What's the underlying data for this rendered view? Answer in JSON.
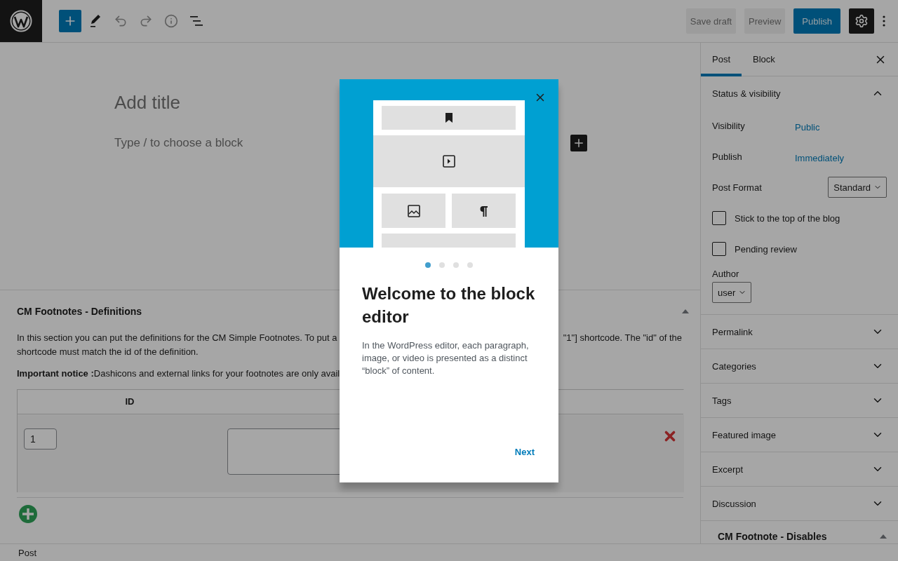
{
  "topbar": {
    "tools": [
      {
        "kind": "inserter",
        "disabled": false
      },
      {
        "kind": "tools",
        "disabled": false
      },
      {
        "kind": "undo",
        "disabled": true
      },
      {
        "kind": "redo",
        "disabled": true
      },
      {
        "kind": "info",
        "disabled": true
      },
      {
        "kind": "list",
        "disabled": false
      }
    ],
    "actions": [
      {
        "label": "Save draft",
        "kind": "tertiary"
      },
      {
        "label": "Preview",
        "kind": "tertiary"
      },
      {
        "label": "Publish",
        "kind": "primary"
      }
    ],
    "settings": {
      "pressed": true
    }
  },
  "editor": {
    "title_placeholder": "Add title",
    "block_placeholder": "Type / to choose a block"
  },
  "metabox": {
    "title": "CM Footnotes - Definitions",
    "expanded": true,
    "intro": [
      "In this section you can put the definitions for the CM Simple Footnotes. To put a",
      "\"1\"] shortcode. The \"id\" of the",
      "shortcode must match the id of the definition."
    ],
    "notice": "**Important notice :**Dashicons and external links for your footnotes are only avail",
    "columns": [
      "ID"
    ],
    "rows": [
      {
        "id": "1"
      }
    ]
  },
  "sidebar": {
    "tabs": [
      {
        "label": "Post",
        "selected": true
      },
      {
        "label": "Block",
        "selected": false
      }
    ],
    "status_panel": {
      "title": "Status & visibility",
      "expanded": true,
      "rows": [
        {
          "label": "Visibility",
          "value": "Public"
        },
        {
          "label": "Publish",
          "value": "Immediately"
        }
      ],
      "post_format": {
        "label": "Post Format",
        "value": "Standard"
      },
      "checkboxes": [
        {
          "label": "Stick to the top of the blog",
          "checked": false
        },
        {
          "label": "Pending review",
          "checked": false
        }
      ],
      "author": {
        "label": "Author",
        "value": "user"
      }
    },
    "panels": [
      {
        "title": "Permalink",
        "expanded": false
      },
      {
        "title": "Categories",
        "expanded": false
      },
      {
        "title": "Tags",
        "expanded": false
      },
      {
        "title": "Featured image",
        "expanded": false
      },
      {
        "title": "Excerpt",
        "expanded": false
      },
      {
        "title": "Discussion",
        "expanded": false
      }
    ],
    "metabox": {
      "title": "CM Footnote - Disables",
      "expanded": true
    }
  },
  "footer": {
    "breadcrumb": "Post"
  },
  "modal": {
    "dots": [
      {
        "selected": true
      },
      {
        "selected": false
      },
      {
        "selected": false
      },
      {
        "selected": false
      }
    ],
    "title": "Welcome to the block editor",
    "text": "In the WordPress editor, each paragraph, image, or video is presented as a distinct “block” of content.",
    "next": "Next"
  }
}
